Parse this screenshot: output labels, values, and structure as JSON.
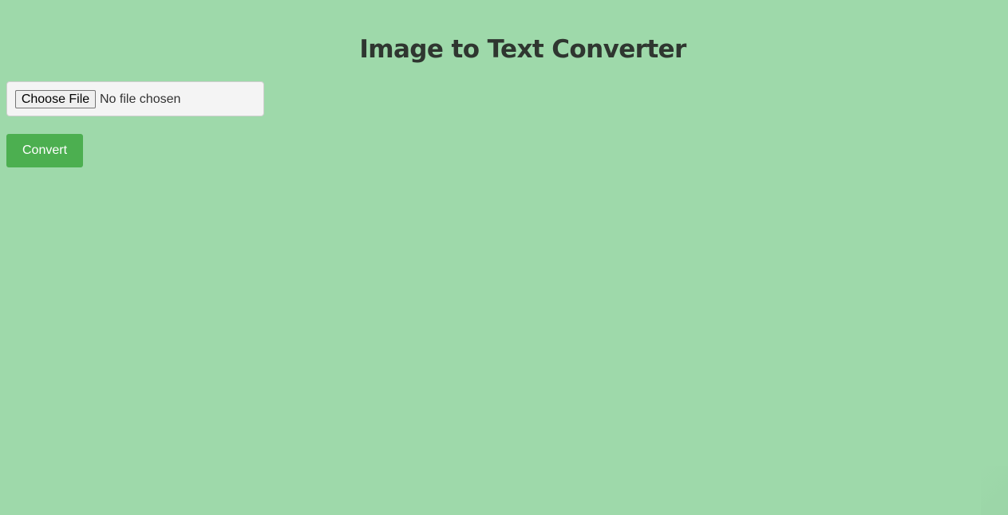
{
  "page": {
    "title": "Image to Text Converter",
    "background_color": "#9ed9aa",
    "accent_color": "#4caf50"
  },
  "upload": {
    "choose_file_label": "Choose File",
    "status_text": "No file chosen"
  },
  "actions": {
    "convert_label": "Convert"
  }
}
